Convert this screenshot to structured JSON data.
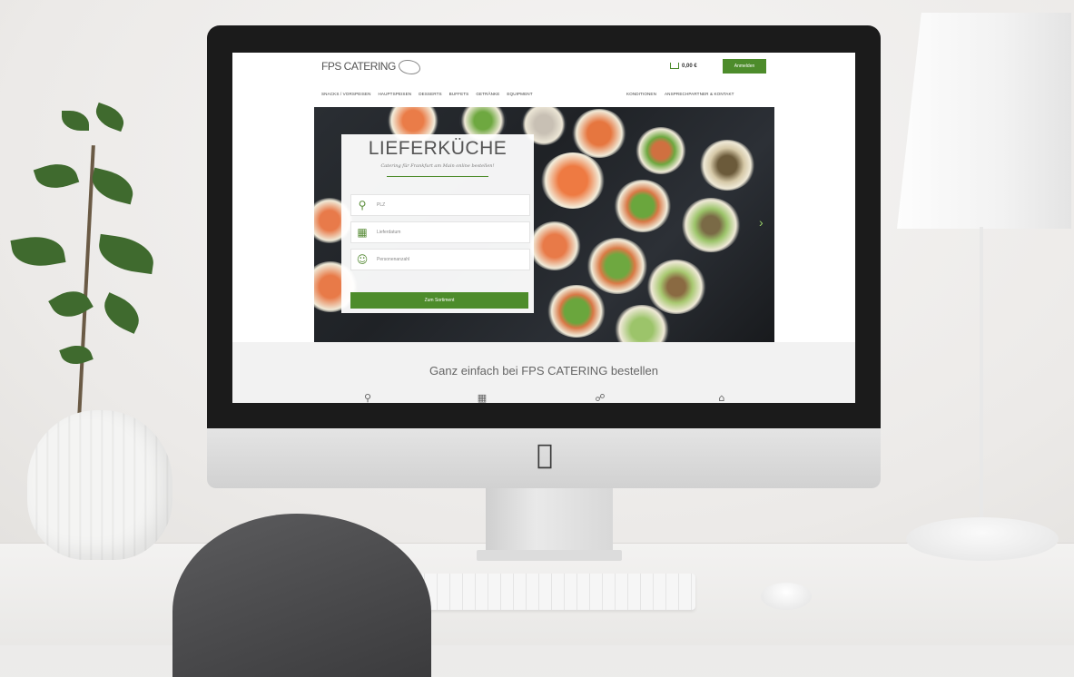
{
  "site": {
    "logo_text": "FPS CATERING",
    "cart_amount": "0,00 €",
    "login_label": "Anmelden",
    "nav_left": [
      "SNACKS / VORSPEISEN",
      "HAUPTSPEISEN",
      "DESSERTS",
      "BUFFETS",
      "GETRÄNKE",
      "EQUIPMENT"
    ],
    "nav_right": [
      "KONDITIONEN",
      "ANSPRECHPARTNER & KONTAKT"
    ]
  },
  "order_form": {
    "title": "LIEFERKÜCHE",
    "subtitle": "Catering für Frankfurt am Main online bestellen!",
    "fields": [
      {
        "icon": "location-pin-icon",
        "placeholder": "PLZ"
      },
      {
        "icon": "calendar-icon",
        "placeholder": "Lieferdatum"
      },
      {
        "icon": "person-icon",
        "placeholder": "Personenanzahl"
      }
    ],
    "submit_label": "Zum Sortiment"
  },
  "info_section": {
    "title": "Ganz einfach bei FPS CATERING bestellen"
  },
  "colors": {
    "brand_green": "#4d8c2b",
    "bezel": "#1b1b1b",
    "hero_dark": "#1f2226"
  }
}
